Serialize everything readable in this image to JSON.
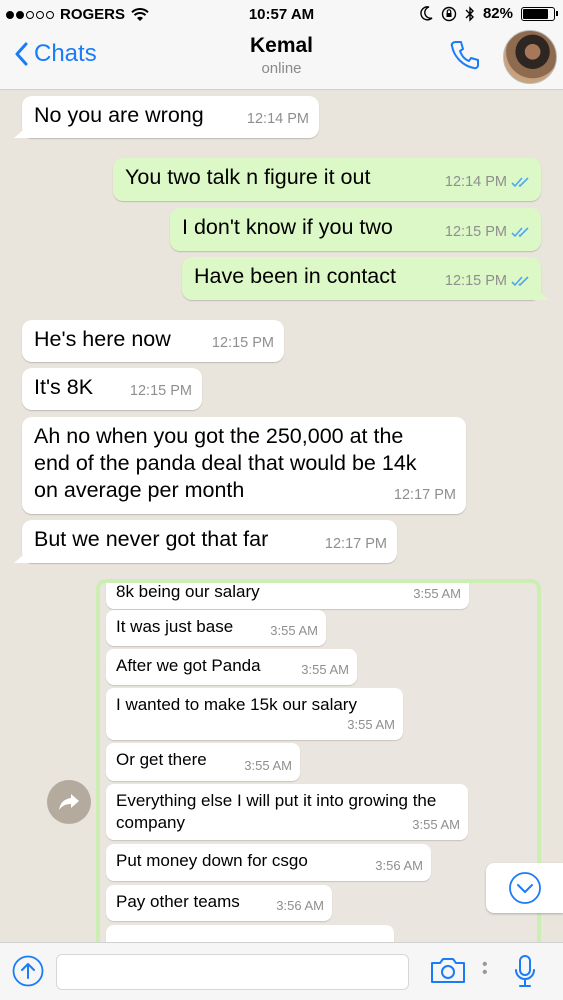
{
  "status_bar": {
    "carrier": "ROGERS",
    "time": "10:57 AM",
    "battery": "82%",
    "battery_level": 0.82
  },
  "header": {
    "back_label": "Chats",
    "contact_name": "Kemal",
    "status": "online"
  },
  "messages": [
    {
      "dir": "in",
      "text": "No you are wrong",
      "time": "12:14 PM"
    },
    {
      "dir": "out",
      "text": "You two talk n figure it out",
      "time": "12:14 PM"
    },
    {
      "dir": "out",
      "text": "I don't know if you two",
      "time": "12:15 PM"
    },
    {
      "dir": "out",
      "text": "Have been in contact",
      "time": "12:15 PM"
    },
    {
      "dir": "in",
      "text": "He's here now",
      "time": "12:15 PM"
    },
    {
      "dir": "in",
      "text": "It's 8K",
      "time": "12:15 PM"
    },
    {
      "dir": "in",
      "text": "Ah no when you got the 250,000 at the end of the panda deal that would be 14k on average per month",
      "time": "12:17 PM"
    },
    {
      "dir": "in",
      "text": "But we never got that far",
      "time": "12:17 PM"
    }
  ],
  "shared_screenshot": {
    "messages": [
      {
        "text": "8k being our salary",
        "time": "3:55 AM"
      },
      {
        "text": "It was just base",
        "time": "3:55 AM"
      },
      {
        "text": "After we got Panda",
        "time": "3:55 AM"
      },
      {
        "text": "I wanted to make 15k our salary",
        "time": "3:55 AM"
      },
      {
        "text": "Or get there",
        "time": "3:55 AM"
      },
      {
        "text": "Everything else I will put it into growing the company",
        "time": "3:55 AM"
      },
      {
        "text": "Put money down for csgo",
        "time": "3:56 AM"
      },
      {
        "text": "Pay other teams",
        "time": "3:56 AM"
      }
    ]
  },
  "icons": {
    "wifi": "wifi-icon",
    "moon": "moon-icon",
    "lock": "orientation-lock-icon",
    "bluetooth": "bluetooth-icon",
    "call": "phone-icon",
    "forward": "forward-icon",
    "scroll": "chevron-down-icon",
    "attach": "upload-icon",
    "camera": "camera-icon",
    "mic": "microphone-icon"
  },
  "colors": {
    "accent": "#1a7cf6",
    "outgoing_bubble": "#dcf8c6",
    "incoming_bubble": "#ffffff",
    "read_ticks": "#4fa7f0"
  }
}
